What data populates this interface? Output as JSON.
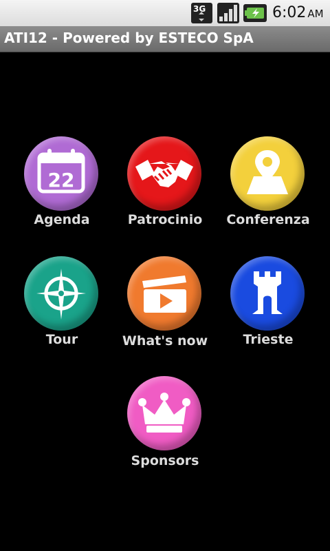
{
  "status_bar": {
    "network": "3G",
    "time": "6:02",
    "ampm": "AM"
  },
  "app": {
    "title": "ATI12 - Powered by ESTECO SpA"
  },
  "menu": {
    "agenda": {
      "label": "Agenda",
      "icon": "calendar-icon",
      "color": "#b06bd4",
      "calendar_day": "22"
    },
    "patrocinio": {
      "label": "Patrocinio",
      "icon": "handshake-icon",
      "color": "#e5171a"
    },
    "conferenza": {
      "label": "Conferenza",
      "icon": "map-pin-icon",
      "color": "#f3d03c"
    },
    "tour": {
      "label": "Tour",
      "icon": "compass-icon",
      "color": "#1aa38a"
    },
    "whats_now": {
      "label": "What's now",
      "icon": "clapperboard-icon",
      "color": "#f07a2e"
    },
    "trieste": {
      "label": "Trieste",
      "icon": "castle-tower-icon",
      "color": "#1a4be0"
    },
    "sponsors": {
      "label": "Sponsors",
      "icon": "crown-icon",
      "color": "#f05cc4"
    }
  }
}
